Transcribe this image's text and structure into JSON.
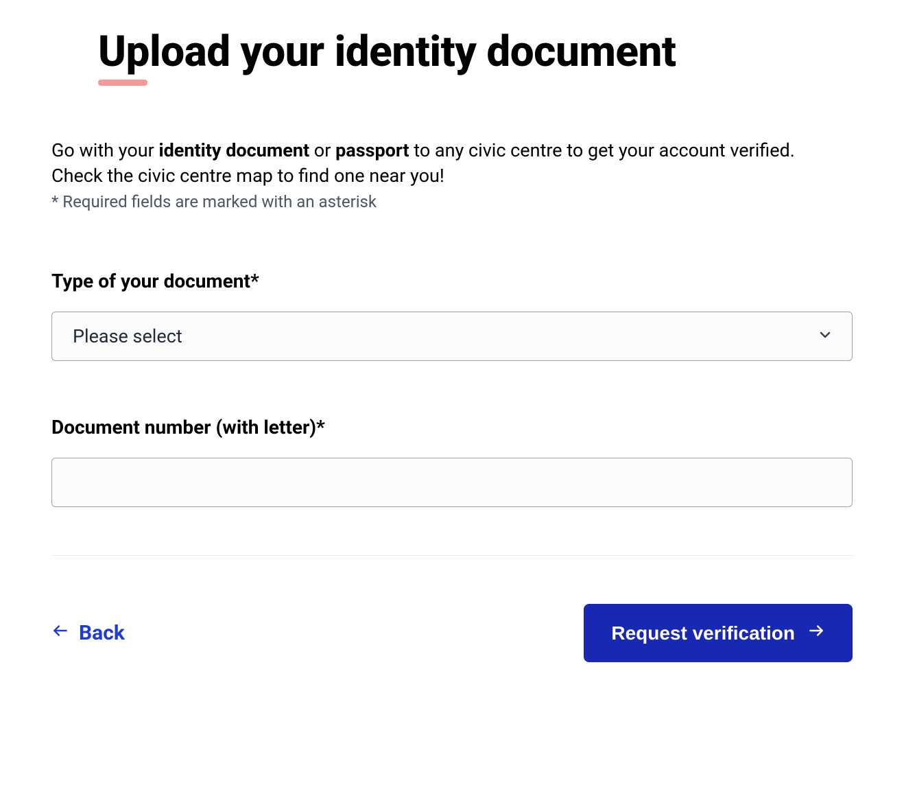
{
  "header": {
    "title": "Upload your identity document"
  },
  "intro": {
    "line1_prefix": "Go with your ",
    "line1_bold1": "identity document",
    "line1_mid": " or ",
    "line1_bold2": "passport",
    "line1_suffix": " to any civic centre to get your account verified.",
    "line2": "Check the civic centre map to find one near you!",
    "required_note": "* Required fields are marked with an asterisk"
  },
  "form": {
    "doc_type": {
      "label": "Type of your document*",
      "selected": "Please select"
    },
    "doc_number": {
      "label": "Document number (with letter)*",
      "value": ""
    }
  },
  "actions": {
    "back_label": "Back",
    "submit_label": "Request verification"
  }
}
